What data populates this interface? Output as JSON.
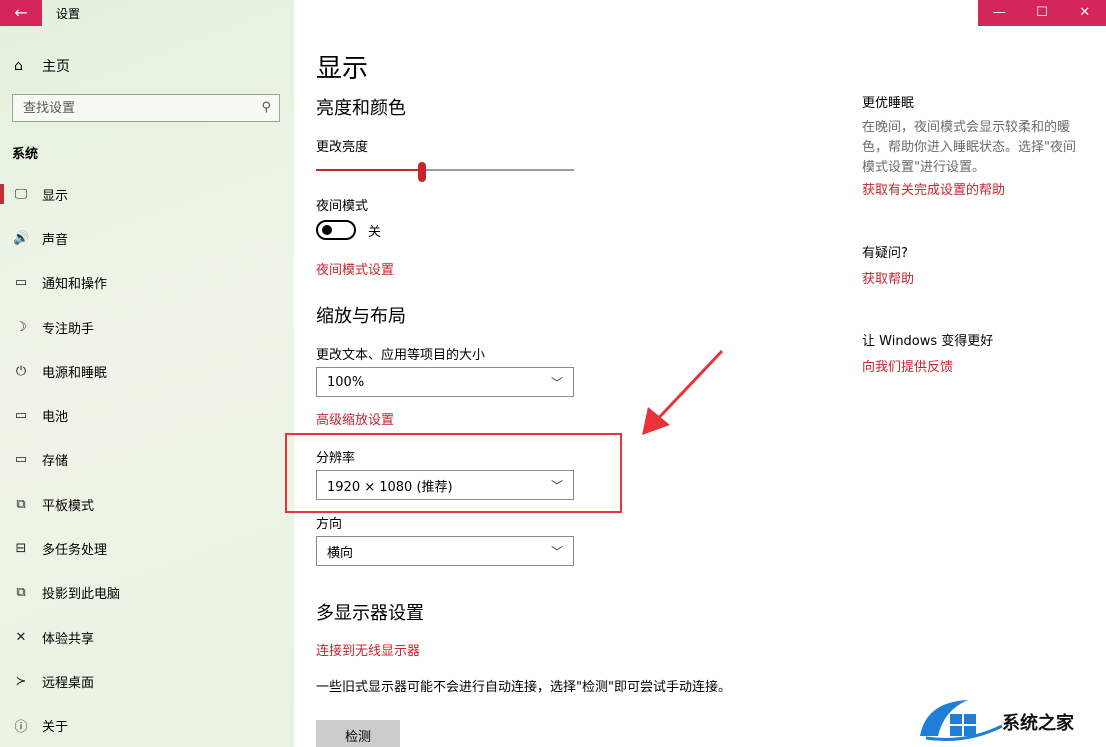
{
  "window": {
    "title": "设置",
    "back_icon": "←",
    "minimize_icon": "—",
    "maximize_icon": "☐",
    "close_icon": "✕"
  },
  "sidebar": {
    "home_label": "主页",
    "search_placeholder": "查找设置",
    "section_label": "系统",
    "items": [
      {
        "label": "显示",
        "icon": "monitor-icon",
        "glyph": "🖵",
        "active": true
      },
      {
        "label": "声音",
        "icon": "speaker-icon",
        "glyph": "🔊",
        "active": false
      },
      {
        "label": "通知和操作",
        "icon": "notification-icon",
        "glyph": "▭",
        "active": false
      },
      {
        "label": "专注助手",
        "icon": "moon-icon",
        "glyph": "☽",
        "active": false
      },
      {
        "label": "电源和睡眠",
        "icon": "power-icon",
        "glyph": "⏻",
        "active": false
      },
      {
        "label": "电池",
        "icon": "battery-icon",
        "glyph": "▭",
        "active": false
      },
      {
        "label": "存储",
        "icon": "storage-icon",
        "glyph": "▭",
        "active": false
      },
      {
        "label": "平板模式",
        "icon": "tablet-icon",
        "glyph": "⧉",
        "active": false
      },
      {
        "label": "多任务处理",
        "icon": "multitask-icon",
        "glyph": "⊟",
        "active": false
      },
      {
        "label": "投影到此电脑",
        "icon": "project-icon",
        "glyph": "⧉",
        "active": false
      },
      {
        "label": "体验共享",
        "icon": "share-icon",
        "glyph": "✕",
        "active": false
      },
      {
        "label": "远程桌面",
        "icon": "remote-icon",
        "glyph": "≻",
        "active": false
      },
      {
        "label": "关于",
        "icon": "info-icon",
        "glyph": "ⓘ",
        "active": false
      }
    ]
  },
  "main": {
    "page_title": "显示",
    "brightness": {
      "heading": "亮度和颜色",
      "label": "更改亮度",
      "level": 0.41
    },
    "night_mode": {
      "label": "夜间模式",
      "state": "关",
      "settings_link": "夜间模式设置"
    },
    "scale": {
      "heading": "缩放与布局",
      "label": "更改文本、应用等项目的大小",
      "value": "100%",
      "advanced_link": "高级缩放设置"
    },
    "resolution": {
      "label": "分辨率",
      "value": "1920 × 1080 (推荐)"
    },
    "orientation": {
      "label": "方向",
      "value": "横向"
    },
    "multi_display": {
      "heading": "多显示器设置",
      "wireless_link": "连接到无线显示器",
      "description": "一些旧式显示器可能不会进行自动连接，选择\"检测\"即可尝试手动连接。",
      "detect_button": "检测"
    }
  },
  "aside": {
    "sleep_title": "更优睡眠",
    "sleep_text": "在晚间，夜间模式会显示较柔和的暖色，帮助你进入睡眠状态。选择\"夜间模式设置\"进行设置。",
    "sleep_link": "获取有关完成设置的帮助",
    "question_title": "有疑问?",
    "help_link": "获取帮助",
    "improve_title": "让 Windows 变得更好",
    "feedback_link": "向我们提供反馈"
  },
  "watermark": {
    "text": "系统之家"
  },
  "colors": {
    "accent": "#c8242e",
    "titlebar": "#d5265b",
    "highlight": "#e8333a"
  }
}
